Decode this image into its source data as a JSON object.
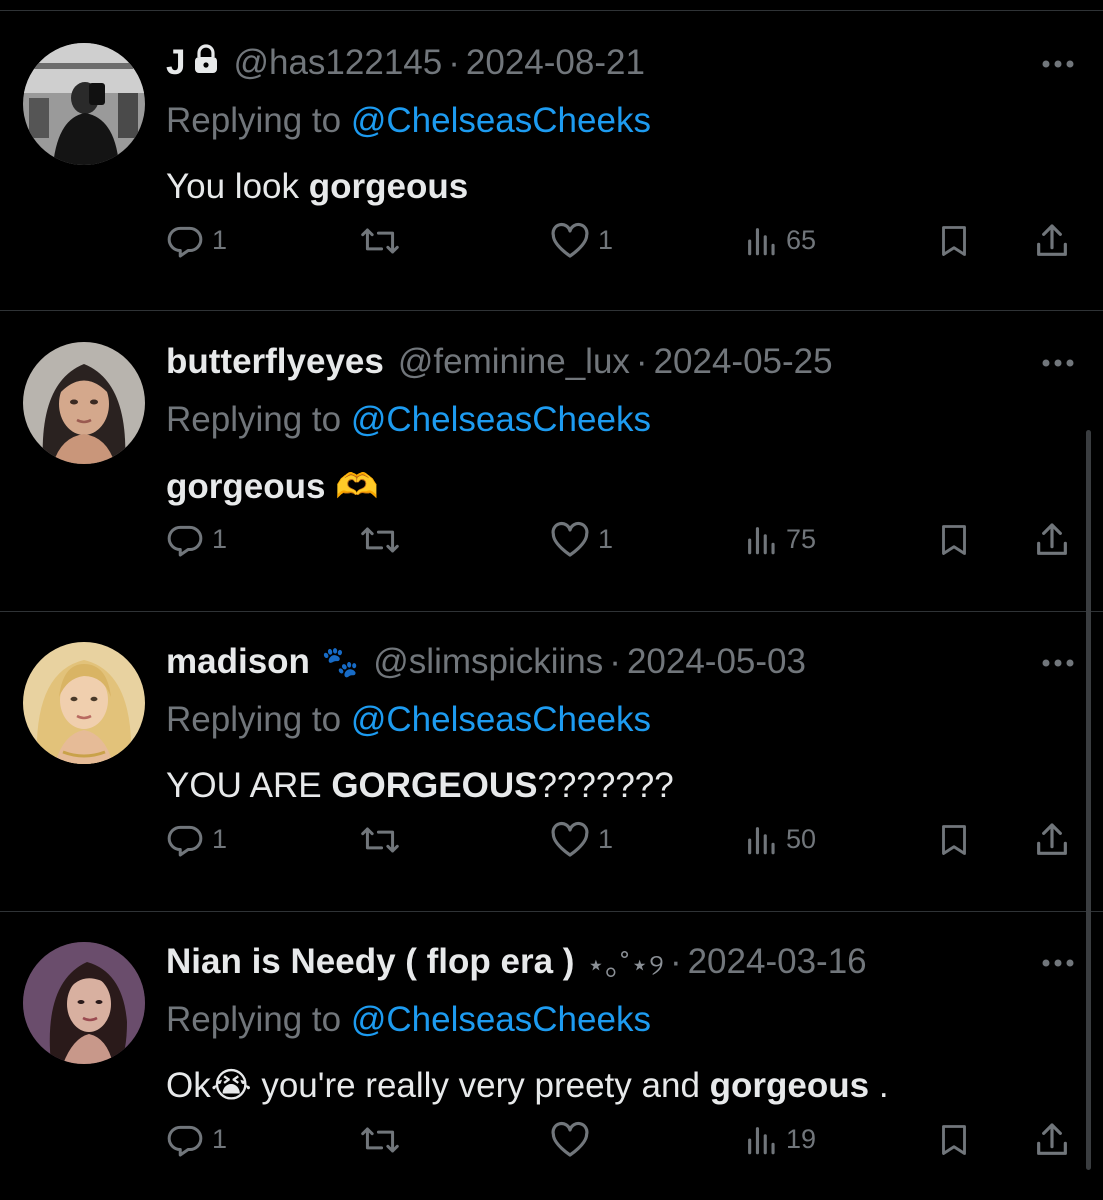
{
  "replies": [
    {
      "name": "J",
      "handle": "@has122145",
      "separator": "·",
      "date": "2024-08-21",
      "replying_prefix": "Replying to",
      "replying_to": "@ChelseasCheeks",
      "text_plain": "You look ",
      "text_bold": "gorgeous",
      "text_after": "",
      "reply_count": "1",
      "like_count": "1",
      "view_count": "65",
      "avatar_icon": "avatar-gym-mirror-selfie"
    },
    {
      "name": "butterflyeyes",
      "handle": "@feminine_lux",
      "separator": "·",
      "date": "2024-05-25",
      "replying_prefix": "Replying to",
      "replying_to": "@ChelseasCheeks",
      "text_plain": "",
      "text_bold": "gorgeous",
      "text_after": " 🫶",
      "reply_count": "1",
      "like_count": "1",
      "view_count": "75",
      "avatar_icon": "avatar-woman-portrait"
    },
    {
      "name": "madison",
      "name_deco": "🐾",
      "handle": "@slimspickiins",
      "separator": "·",
      "date": "2024-05-03",
      "replying_prefix": "Replying to",
      "replying_to": "@ChelseasCheeks",
      "text_plain": "YOU ARE ",
      "text_bold": "GORGEOUS",
      "text_after": "???????",
      "reply_count": "1",
      "like_count": "1",
      "view_count": "50",
      "avatar_icon": "avatar-blonde-woman"
    },
    {
      "name": "Nian is Needy ( flop era )",
      "name_deco": "⋆｡˚⋆୨",
      "handle": "",
      "separator": "·",
      "date": "2024-03-16",
      "replying_prefix": "Replying to",
      "replying_to": "@ChelseasCheeks",
      "text_plain": "Ok😭 you're really very preety and ",
      "text_bold": "gorgeous",
      "text_after": "  .",
      "reply_count": "1",
      "like_count": "",
      "view_count": "19",
      "avatar_icon": "avatar-woman-dark-hair"
    }
  ],
  "colors": {
    "background": "#000000",
    "text": "#e7e9ea",
    "secondary": "#71767b",
    "mention": "#1d9bf0",
    "divider": "#2f3336"
  }
}
